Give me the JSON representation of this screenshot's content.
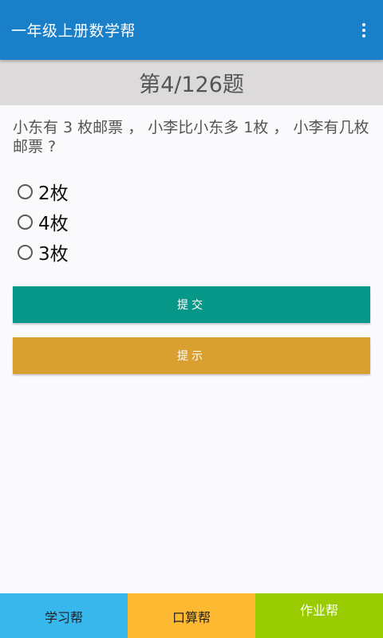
{
  "appbar": {
    "title": "一年级上册数学帮",
    "overflow_icon": "more-vert-icon",
    "color": "#1a7fc9"
  },
  "question_header": {
    "label": "第4/126题"
  },
  "question": {
    "text": "小东有 3 枚邮票 ， 小李比小东多 1枚 ， 小李有几枚邮票 ?"
  },
  "options": [
    {
      "label": "2枚",
      "selected": false
    },
    {
      "label": "4枚",
      "selected": false
    },
    {
      "label": "3枚",
      "selected": false
    }
  ],
  "buttons": {
    "submit_label": "提交",
    "hint_label": "提示",
    "submit_color": "#079788",
    "hint_color": "#d9a030"
  },
  "bottom_tabs": [
    {
      "label": "学习帮",
      "color": "#38b7ec"
    },
    {
      "label": "口算帮",
      "color": "#fdb932"
    },
    {
      "label": "作业帮",
      "color": "#99cc00"
    }
  ]
}
